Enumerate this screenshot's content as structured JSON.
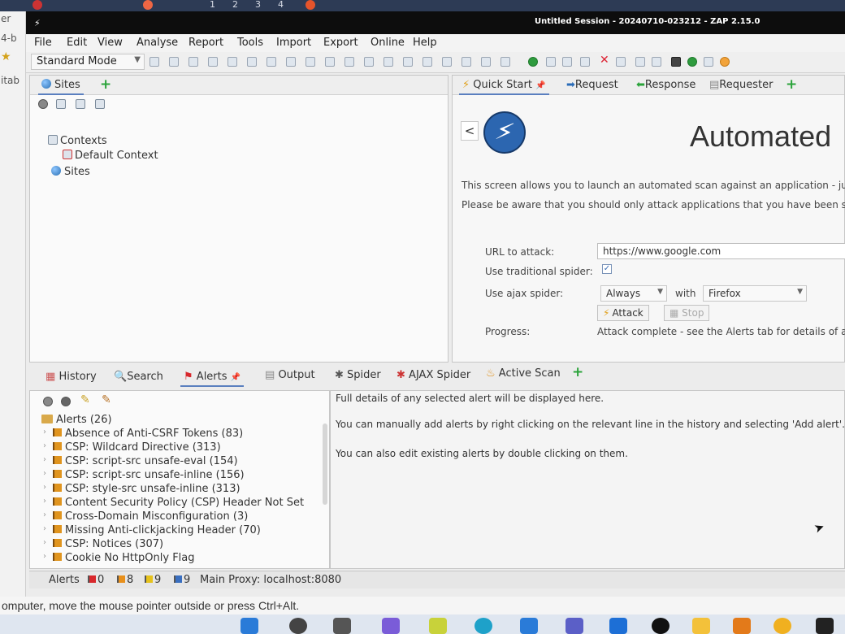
{
  "host": {
    "workspaces": [
      "1",
      "2",
      "3",
      "4"
    ],
    "left_strip": [
      "er",
      "4-b",
      "itab"
    ],
    "message": "omputer, move the mouse pointer outside or press Ctrl+Alt."
  },
  "window": {
    "title": "Untitled Session - 20240710-023212 - ZAP 2.15.0"
  },
  "menu": [
    "File",
    "Edit",
    "View",
    "Analyse",
    "Report",
    "Tools",
    "Import",
    "Export",
    "Online",
    "Help"
  ],
  "toolbar": {
    "mode": "Standard Mode"
  },
  "sites": {
    "tab_label": "Sites",
    "tree": {
      "contexts": "Contexts",
      "default_context": "Default Context",
      "sites": "Sites"
    }
  },
  "right_tabs": {
    "quick_start": "Quick Start",
    "request": "Request",
    "response": "Response",
    "requester": "Requester"
  },
  "quick_start": {
    "back": "<",
    "heading": "Automated",
    "desc1": "This screen allows you to launch an automated scan against  an application - jus",
    "desc2": "Please be aware that you should only attack applications that you have been sp",
    "url_label": "URL to attack:",
    "url_value": "https://www.google.com",
    "trad_spider_label": "Use traditional spider:",
    "trad_spider_checked": "✓",
    "ajax_label": "Use ajax spider:",
    "ajax_option": "Always",
    "with_label": "with",
    "browser_option": "Firefox",
    "attack_button": "Attack",
    "stop_button": "Stop",
    "progress_label": "Progress:",
    "progress_value": "Attack complete - see the Alerts tab for details of an"
  },
  "bottom_tabs": {
    "history": "History",
    "search": "Search",
    "alerts": "Alerts",
    "output": "Output",
    "spider": "Spider",
    "ajax_spider": "AJAX Spider",
    "active_scan": "Active Scan"
  },
  "alerts": {
    "root": "Alerts (26)",
    "items": [
      "Absence of Anti-CSRF Tokens (83)",
      "CSP: Wildcard Directive (313)",
      "CSP: script-src unsafe-eval (154)",
      "CSP: script-src unsafe-inline (156)",
      "CSP: style-src unsafe-inline (313)",
      "Content Security Policy (CSP) Header Not Set",
      "Cross-Domain Misconfiguration (3)",
      "Missing Anti-clickjacking Header (70)",
      "CSP: Notices (307)",
      "Cookie No HttpOnly Flag"
    ]
  },
  "details": {
    "line1": "Full details of any selected alert will be displayed here.",
    "line2": "You can manually add alerts by right clicking on the relevant line in the history and selecting 'Add alert'.",
    "line3": "You can also edit existing alerts by double clicking on them."
  },
  "status": {
    "alerts_label": "Alerts",
    "high": "0",
    "medium": "8",
    "low": "9",
    "info": "9",
    "proxy": "Main Proxy: localhost:8080"
  },
  "colors": {
    "flag_high": "#d8282c",
    "flag_medium": "#e8901c",
    "flag_low": "#e6c21c",
    "flag_info": "#3a6fc0",
    "accent": "#5a7fbf"
  }
}
